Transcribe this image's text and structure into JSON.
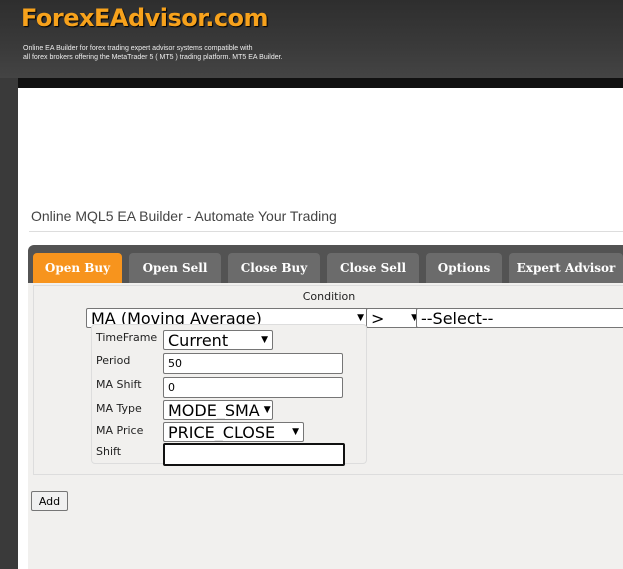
{
  "site": {
    "logo": "ForexEAdvisor.com",
    "tagline_line1": "Online EA Builder for forex trading expert advisor systems compatible with",
    "tagline_line2": "all forex brokers offering the MetaTrader 5 ( MT5 ) trading platform. MT5 EA Builder."
  },
  "page": {
    "title": "Online MQL5 EA Builder - Automate Your Trading"
  },
  "tabs": [
    {
      "label": "Open Buy",
      "active": true
    },
    {
      "label": "Open Sell",
      "active": false
    },
    {
      "label": "Close Buy",
      "active": false
    },
    {
      "label": "Close Sell",
      "active": false
    },
    {
      "label": "Options",
      "active": false
    },
    {
      "label": "Expert Advisor",
      "active": false
    }
  ],
  "condition": {
    "heading": "Condition",
    "indicator": "MA (Moving Average)",
    "operator": ">",
    "compare_to": "--Select--"
  },
  "params": {
    "timeframe_label": "TimeFrame",
    "timeframe_value": "Current",
    "period_label": "Period",
    "period_value": "50",
    "ma_shift_label": "MA Shift",
    "ma_shift_value": "0",
    "ma_type_label": "MA Type",
    "ma_type_value": "MODE_SMA",
    "ma_price_label": "MA Price",
    "ma_price_value": "PRICE_CLOSE",
    "shift_label": "Shift",
    "shift_value": ""
  },
  "actions": {
    "add_label": "Add"
  },
  "colors": {
    "logo": "#f7a21c",
    "active_tab": "#f7941d",
    "tab": "#6b6b6b",
    "tabbar": "#535353"
  }
}
